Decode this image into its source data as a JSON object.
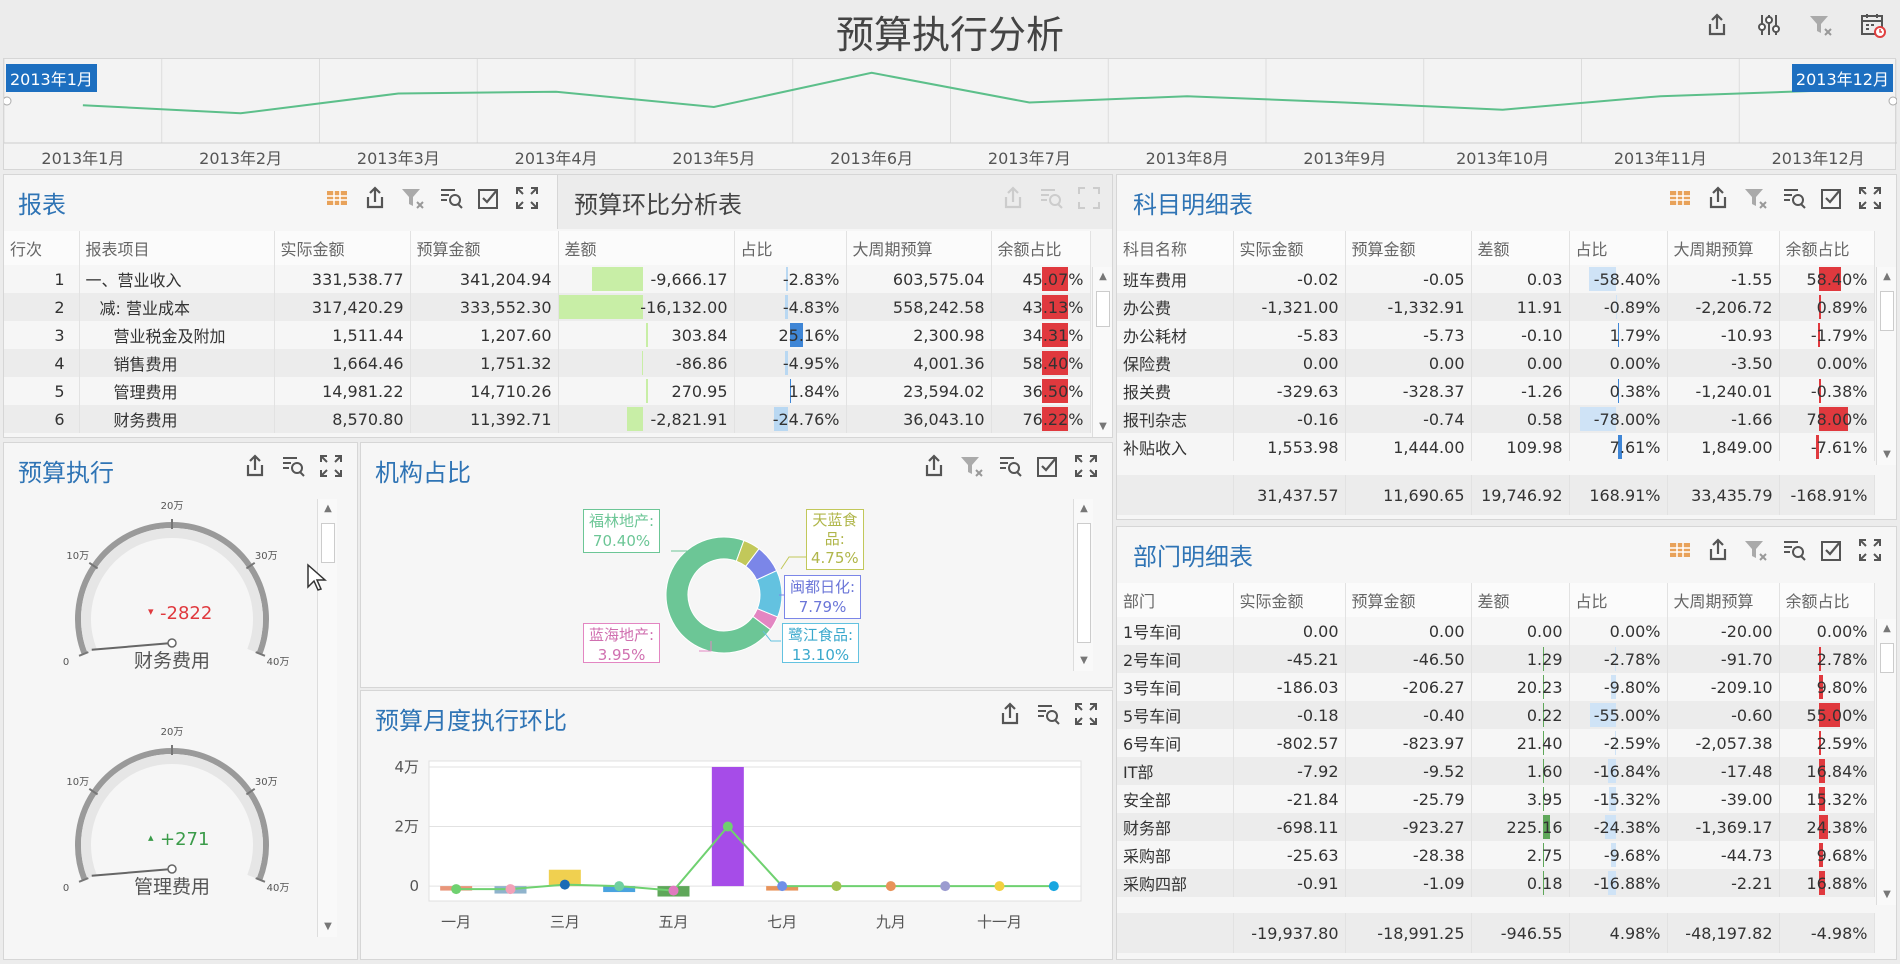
{
  "header": {
    "title": "预算执行分析",
    "icons": [
      "share-icon",
      "settings-sliders-icon",
      "clear-filter-icon",
      "calendar-icon"
    ]
  },
  "timeline": {
    "start_badge": "2013年1月",
    "end_badge": "2013年12月",
    "months": [
      "2013年1月",
      "2013年2月",
      "2013年3月",
      "2013年4月",
      "2013年5月",
      "2013年6月",
      "2013年7月",
      "2013年8月",
      "2013年9月",
      "2013年10月",
      "2013年11月",
      "2013年12月"
    ],
    "values": [
      0.42,
      0.33,
      0.55,
      0.57,
      0.4,
      0.78,
      0.45,
      0.52,
      0.45,
      0.37,
      0.52,
      0.58
    ]
  },
  "report": {
    "title": "报表",
    "tab_title": "预算环比分析表",
    "columns": [
      "行次",
      "报表项目",
      "实际金额",
      "预算金额",
      "差额",
      "占比",
      "大周期预算",
      "余额占比"
    ],
    "rows": [
      {
        "no": "1",
        "item": "一、营业收入",
        "indent": 0,
        "actual": "331,538.77",
        "budget": "341,204.94",
        "diff": "-9,666.17",
        "diff_bar": -0.6,
        "ratio": "-2.83%",
        "ratio_bar": -0.03,
        "period": "603,575.04",
        "balance": "45.07%",
        "bal_bar": 0.45
      },
      {
        "no": "2",
        "item": "减: 营业成本",
        "indent": 1,
        "actual": "317,420.29",
        "budget": "333,552.30",
        "diff": "-16,132.00",
        "diff_bar": -1.0,
        "ratio": "-4.83%",
        "ratio_bar": -0.05,
        "period": "558,242.58",
        "balance": "43.13%",
        "bal_bar": 0.43
      },
      {
        "no": "3",
        "item": "营业税金及附加",
        "indent": 2,
        "actual": "1,511.44",
        "budget": "1,207.60",
        "diff": "303.84",
        "diff_bar": 0.02,
        "ratio": "25.16%",
        "ratio_bar": 0.25,
        "period": "2,300.98",
        "balance": "34.31%",
        "bal_bar": 0.34
      },
      {
        "no": "4",
        "item": "销售费用",
        "indent": 2,
        "actual": "1,664.46",
        "budget": "1,751.32",
        "diff": "-86.86",
        "diff_bar": -0.01,
        "ratio": "-4.95%",
        "ratio_bar": -0.05,
        "period": "4,001.36",
        "balance": "58.40%",
        "bal_bar": 0.58
      },
      {
        "no": "5",
        "item": "管理费用",
        "indent": 2,
        "actual": "14,981.22",
        "budget": "14,710.26",
        "diff": "270.95",
        "diff_bar": 0.02,
        "ratio": "1.84%",
        "ratio_bar": 0.02,
        "period": "23,594.02",
        "balance": "36.50%",
        "bal_bar": 0.36
      },
      {
        "no": "6",
        "item": "财务费用",
        "indent": 2,
        "actual": "8,570.80",
        "budget": "11,392.71",
        "diff": "-2,821.91",
        "diff_bar": -0.18,
        "ratio": "-24.76%",
        "ratio_bar": -0.25,
        "period": "36,043.10",
        "balance": "76.22%",
        "bal_bar": 0.76
      }
    ]
  },
  "subject": {
    "title": "科目明细表",
    "columns": [
      "科目名称",
      "实际金额",
      "预算金额",
      "差额",
      "占比",
      "大周期预算",
      "余额占比"
    ],
    "rows": [
      {
        "name": "班车费用",
        "actual": "-0.02",
        "budget": "-0.05",
        "diff": "0.03",
        "ratio": "-58.40%",
        "ratio_bar": -0.58,
        "period": "-1.55",
        "balance": "58.40%",
        "bal_bar": 0.58
      },
      {
        "name": "办公费",
        "actual": "-1,321.00",
        "budget": "-1,332.91",
        "diff": "11.91",
        "ratio": "-0.89%",
        "ratio_bar": -0.01,
        "period": "-2,206.72",
        "balance": "0.89%",
        "bal_bar": 0.01
      },
      {
        "name": "办公耗材",
        "actual": "-5.83",
        "budget": "-5.73",
        "diff": "-0.10",
        "ratio": "1.79%",
        "ratio_bar": 0.02,
        "period": "-10.93",
        "balance": "-1.79%",
        "bal_bar": -0.02
      },
      {
        "name": "保险费",
        "actual": "0.00",
        "budget": "0.00",
        "diff": "0.00",
        "ratio": "0.00%",
        "ratio_bar": 0,
        "period": "-3.50",
        "balance": "0.00%",
        "bal_bar": 0
      },
      {
        "name": "报关费",
        "actual": "-329.63",
        "budget": "-328.37",
        "diff": "-1.26",
        "ratio": "0.38%",
        "ratio_bar": 0.004,
        "period": "-1,240.01",
        "balance": "-0.38%",
        "bal_bar": -0.004
      },
      {
        "name": "报刊杂志",
        "actual": "-0.16",
        "budget": "-0.74",
        "diff": "0.58",
        "ratio": "-78.00%",
        "ratio_bar": -0.78,
        "period": "-1.66",
        "balance": "78.00%",
        "bal_bar": 0.78
      },
      {
        "name": "补贴收入",
        "actual": "1,553.98",
        "budget": "1,444.00",
        "diff": "109.98",
        "ratio": "7.61%",
        "ratio_bar": 0.08,
        "period": "1,849.00",
        "balance": "-7.61%",
        "bal_bar": -0.08
      }
    ],
    "summary": [
      "31,437.57",
      "11,690.65",
      "19,746.92",
      "168.91%",
      "33,435.79",
      "-168.91%"
    ]
  },
  "dept": {
    "title": "部门明细表",
    "columns": [
      "部门",
      "实际金额",
      "预算金额",
      "差额",
      "占比",
      "大周期预算",
      "余额占比"
    ],
    "rows": [
      {
        "name": "1号车间",
        "actual": "0.00",
        "budget": "0.00",
        "diff": "0.00",
        "diff_bar": 0,
        "ratio": "0.00%",
        "ratio_bar": 0,
        "period": "-20.00",
        "balance": "0.00%",
        "bal_bar": 0
      },
      {
        "name": "2号车间",
        "actual": "-45.21",
        "budget": "-46.50",
        "diff": "1.29",
        "diff_bar": 0.01,
        "ratio": "-2.78%",
        "ratio_bar": -0.03,
        "period": "-91.70",
        "balance": "2.78%",
        "bal_bar": 0.03
      },
      {
        "name": "3号车间",
        "actual": "-186.03",
        "budget": "-206.27",
        "diff": "20.23",
        "diff_bar": 0.05,
        "ratio": "-9.80%",
        "ratio_bar": -0.1,
        "period": "-209.10",
        "balance": "9.80%",
        "bal_bar": 0.1
      },
      {
        "name": "5号车间",
        "actual": "-0.18",
        "budget": "-0.40",
        "diff": "0.22",
        "diff_bar": 0.005,
        "ratio": "-55.00%",
        "ratio_bar": -0.55,
        "period": "-0.60",
        "balance": "55.00%",
        "bal_bar": 0.55
      },
      {
        "name": "6号车间",
        "actual": "-802.57",
        "budget": "-823.97",
        "diff": "21.40",
        "diff_bar": 0.05,
        "ratio": "-2.59%",
        "ratio_bar": -0.03,
        "period": "-2,057.38",
        "balance": "2.59%",
        "bal_bar": 0.03
      },
      {
        "name": "IT部",
        "actual": "-7.92",
        "budget": "-9.52",
        "diff": "1.60",
        "diff_bar": 0.01,
        "ratio": "-16.84%",
        "ratio_bar": -0.17,
        "period": "-17.48",
        "balance": "16.84%",
        "bal_bar": 0.17
      },
      {
        "name": "安全部",
        "actual": "-21.84",
        "budget": "-25.79",
        "diff": "3.95",
        "diff_bar": 0.01,
        "ratio": "-15.32%",
        "ratio_bar": -0.15,
        "period": "-39.00",
        "balance": "15.32%",
        "bal_bar": 0.15
      },
      {
        "name": "财务部",
        "actual": "-698.11",
        "budget": "-923.27",
        "diff": "225.16",
        "diff_bar": 0.5,
        "ratio": "-24.38%",
        "ratio_bar": -0.24,
        "period": "-1,369.17",
        "balance": "24.38%",
        "bal_bar": 0.24
      },
      {
        "name": "采购部",
        "actual": "-25.63",
        "budget": "-28.38",
        "diff": "2.75",
        "diff_bar": 0.01,
        "ratio": "-9.68%",
        "ratio_bar": -0.1,
        "period": "-44.73",
        "balance": "9.68%",
        "bal_bar": 0.1
      },
      {
        "name": "采购四部",
        "actual": "-0.91",
        "budget": "-1.09",
        "diff": "0.18",
        "diff_bar": 0.005,
        "ratio": "-16.88%",
        "ratio_bar": -0.17,
        "period": "-2.21",
        "balance": "16.88%",
        "bal_bar": 0.17
      }
    ],
    "summary": [
      "-19,937.80",
      "-18,991.25",
      "-946.55",
      "4.98%",
      "-48,197.82",
      "-4.98%"
    ]
  },
  "exec": {
    "title": "预算执行",
    "gauges": [
      {
        "label": "财务费用",
        "value": "-2822",
        "dir": "▾",
        "color": "#e0393e",
        "needle": 0.02,
        "ticks": [
          "0",
          "10万",
          "20万",
          "30万",
          "40万"
        ]
      },
      {
        "label": "管理费用",
        "value": "+271",
        "dir": "▴",
        "color": "#3a9b49",
        "needle": 0.02,
        "ticks": [
          "0",
          "10万",
          "20万",
          "30万",
          "40万"
        ]
      }
    ]
  },
  "org": {
    "title": "机构占比",
    "slices": [
      {
        "name": "福林地产",
        "pct": "70.40%",
        "value": 70.4,
        "color": "#6cc696"
      },
      {
        "name": "天蓝食品",
        "pct": "4.75%",
        "value": 4.75,
        "color": "#c2c85a"
      },
      {
        "name": "闽都日化",
        "pct": "7.79%",
        "value": 7.79,
        "color": "#7b86e8"
      },
      {
        "name": "鹭江食品",
        "pct": "13.10%",
        "value": 13.1,
        "color": "#63c2e0"
      },
      {
        "name": "蓝海地产",
        "pct": "3.95%",
        "value": 3.95,
        "color": "#e386c2"
      }
    ],
    "labels": {
      "fulin": [
        "福林地产:",
        "70.40%"
      ],
      "tianlan": [
        "天蓝食",
        "品:",
        "4.75%"
      ],
      "mindu": [
        "闽都日化:",
        "7.79%"
      ],
      "lujiang": [
        "鹭江食品:",
        "13.10%"
      ],
      "lanhai": [
        "蓝海地产:",
        "3.95%"
      ]
    }
  },
  "monthly": {
    "title": "预算月度执行环比",
    "chart_data": {
      "type": "bar",
      "categories": [
        "一月",
        "二月",
        "三月",
        "四月",
        "五月",
        "六月",
        "七月",
        "八月",
        "九月",
        "十月",
        "十一月",
        "十二月"
      ],
      "x_tick_labels": [
        "一月",
        "三月",
        "五月",
        "七月",
        "九月",
        "十一月"
      ],
      "y_tick_labels": [
        "4万",
        "2万",
        "0"
      ],
      "ylim": [
        -5000,
        42000
      ],
      "bars": [
        -1500,
        -2500,
        5500,
        -2000,
        -3500,
        40000,
        -1500,
        0,
        0,
        0,
        0,
        0
      ],
      "bar_colors": [
        "#e9967a",
        "#8fb3cc",
        "#f0d050",
        "#4aa3df",
        "#5fa75a",
        "#a64ce8",
        "#e8935a",
        "#aaaaaa",
        "#aaaaaa",
        "#aaaaaa",
        "#aaaaaa",
        "#aaaaaa"
      ],
      "line": [
        -1000,
        -1000,
        500,
        0,
        -1500,
        20000,
        0,
        0,
        0,
        0,
        0,
        0
      ],
      "point_colors": [
        "#6fd170",
        "#f2a1b8",
        "#1b6bb6",
        "#6fd0a0",
        "#e17ac0",
        "#6fd170",
        "#6f8fe8",
        "#a4c250",
        "#e8935a",
        "#9b9bd0",
        "#f2d040",
        "#17a6e0"
      ]
    }
  }
}
